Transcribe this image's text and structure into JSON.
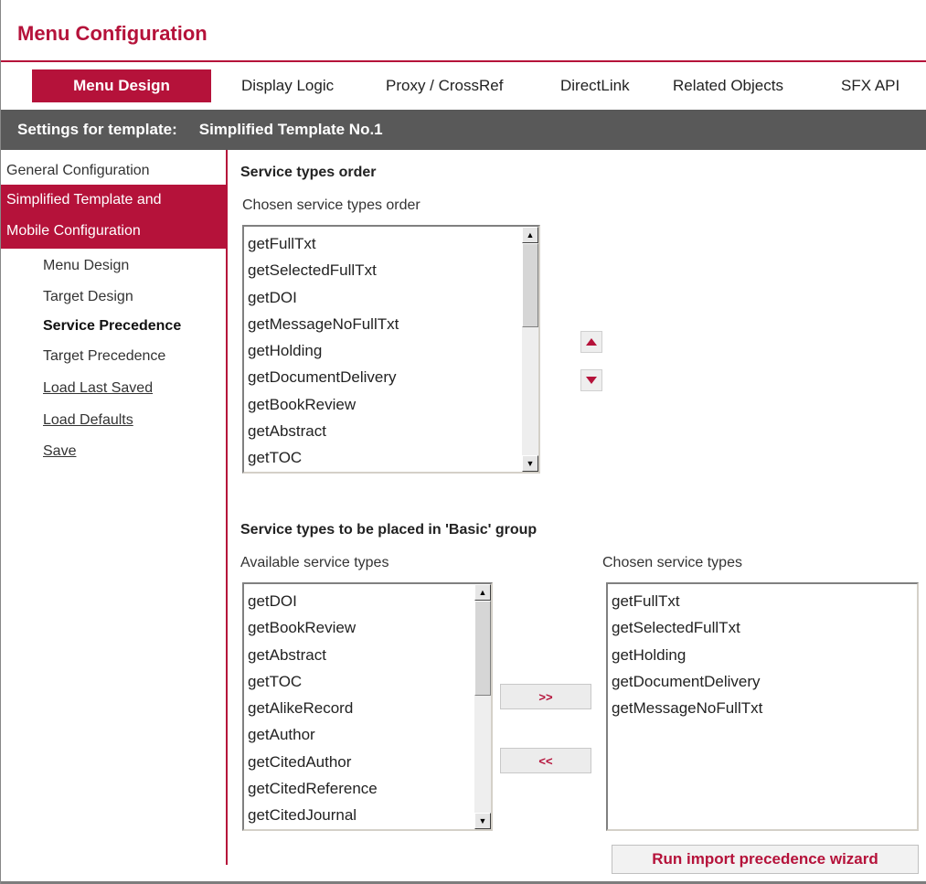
{
  "page": {
    "title": "Menu Configuration"
  },
  "tabs": {
    "active": "Menu Design",
    "items": [
      "Display Logic",
      "Proxy / CrossRef",
      "DirectLink",
      "Related Objects",
      "SFX API"
    ]
  },
  "settings": {
    "label": "Settings for template:",
    "value": "Simplified Template No.1"
  },
  "sidebar": {
    "general": "General Configuration",
    "active_line1": "Simplified Template and",
    "active_line2": "Mobile Configuration",
    "sub_items": [
      "Menu Design",
      "Target Design",
      "Service Precedence",
      "Target Precedence"
    ],
    "links": [
      "Load Last Saved",
      "Load Defaults",
      "Save"
    ]
  },
  "order_section": {
    "heading": "Service types order",
    "label": "Chosen service types order",
    "items": [
      "getFullTxt",
      "getSelectedFullTxt",
      "getDOI",
      "getMessageNoFullTxt",
      "getHolding",
      "getDocumentDelivery",
      "getBookReview",
      "getAbstract",
      "getTOC"
    ]
  },
  "basic_section": {
    "heading": "Service types to be placed in 'Basic' group",
    "available_label": "Available service types",
    "chosen_label": "Chosen service types",
    "available": [
      "getDOI",
      "getBookReview",
      "getAbstract",
      "getTOC",
      "getAlikeRecord",
      "getAuthor",
      "getCitedAuthor",
      "getCitedReference",
      "getCitedJournal"
    ],
    "chosen": [
      "getFullTxt",
      "getSelectedFullTxt",
      "getHolding",
      "getDocumentDelivery",
      "getMessageNoFullTxt"
    ],
    "add_label": ">>",
    "remove_label": "<<"
  },
  "wizard_button": "Run import precedence wizard",
  "colors": {
    "accent": "#b5123a",
    "bar": "#595959"
  },
  "icons": {
    "up": "arrow-up-icon",
    "down": "arrow-down-icon"
  }
}
